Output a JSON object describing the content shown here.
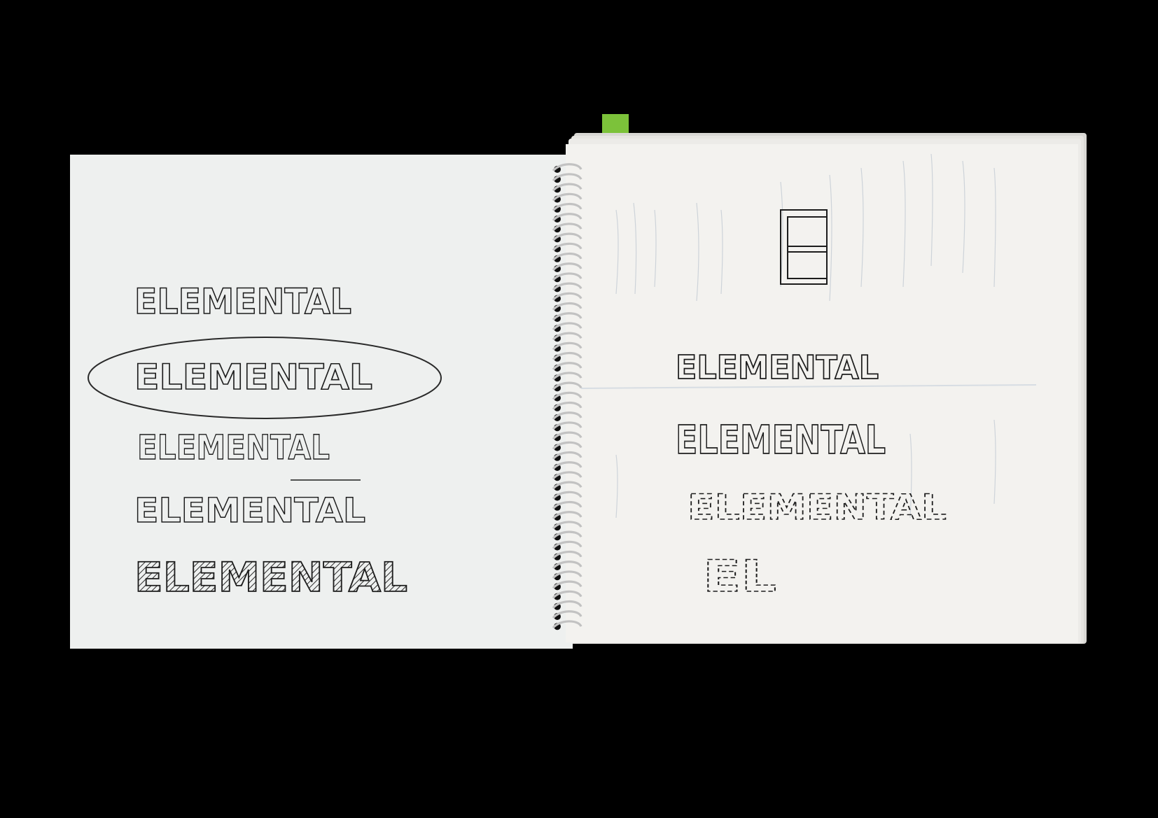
{
  "colors": {
    "background": "#000000",
    "page_left": "#eef0ef",
    "page_right": "#f2f1ee",
    "ink": "#1c1c1c",
    "bookmark": "#7cc23a",
    "spiral": "#b9b9b9",
    "faint_writing": "#b8c4cf"
  },
  "left_page": {
    "sketches": [
      {
        "text": "ELEMENTAL",
        "style": "outline"
      },
      {
        "text": "ELEMENTAL",
        "style": "outline-circled"
      },
      {
        "text": "ELEMENTAL",
        "style": "outline-thin"
      },
      {
        "text": "ELEMENTAL",
        "style": "outline-crossed"
      },
      {
        "text": "ELEMENTAL",
        "style": "hatched-bold"
      }
    ]
  },
  "right_page": {
    "monogram": "E",
    "sketches": [
      {
        "text": "ELEMENTAL",
        "style": "outline"
      },
      {
        "text": "ELEMENTAL",
        "style": "double-outline"
      },
      {
        "text": "ELEMENTAL",
        "style": "dashed"
      },
      {
        "text": "EL",
        "style": "dashed-small"
      }
    ]
  },
  "icons": {
    "bookmark": "bookmark-tab-icon",
    "spiral": "spiral-binding-icon"
  }
}
